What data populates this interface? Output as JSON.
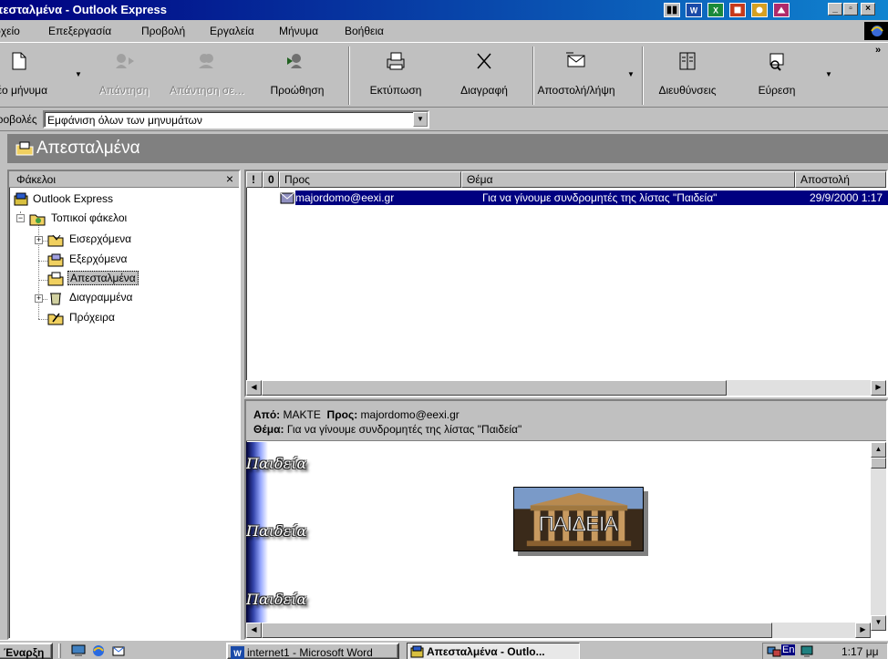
{
  "window": {
    "title": "Απεσταλμένα - Outlook Express"
  },
  "menu": [
    "Αρχείο",
    "Επεξεργασία",
    "Προβολή",
    "Εργαλεία",
    "Μήνυμα",
    "Βοήθεια"
  ],
  "toolbar": {
    "new_message": "Νέο μήνυμα",
    "reply": "Απάντηση",
    "reply_all": "Απάντηση σε όλους",
    "forward": "Προώθηση",
    "print": "Εκτύπωση",
    "delete": "Διαγραφή",
    "send_receive": "Αποστολή/λήψη",
    "addresses": "Διευθύνσεις",
    "find": "Εύρεση"
  },
  "viewbar": {
    "label": "Προβολές",
    "value": "Εμφάνιση όλων των μηνυμάτων"
  },
  "folder_header": "Απεσταλμένα",
  "folders": {
    "title": "Φάκελοι",
    "close": "×",
    "root": "Outlook Express",
    "local": "Τοπικοί φάκελοι",
    "inbox": "Εισερχόμενα",
    "outbox": "Εξερχόμενα",
    "sent": "Απεσταλμένα",
    "deleted": "Διαγραμμένα",
    "drafts": "Πρόχειρα"
  },
  "columns": {
    "priority": "!",
    "attach": "0",
    "to": "Προς",
    "subject": "Θέμα",
    "sent": "Αποστολή"
  },
  "messages": [
    {
      "to": "majordomo@eexi.gr",
      "subject": "Για να γίνουμε συνδρομητές της λίστας \"Παιδεία\"",
      "sent": "29/9/2000 1:17"
    }
  ],
  "preview": {
    "from_label": "Από:",
    "from": "MAKTE",
    "to_label": "Προς:",
    "to": "majordomo@eexi.gr",
    "subject_label": "Θέμα:",
    "subject": "Για να γίνουμε συνδρομητές της λίστας \"Παιδεία\"",
    "logo_text": "Παιδεία",
    "banner_text": "ΠΑΙΔΕΙΑ"
  },
  "taskbar": {
    "start": "Έναρξη",
    "tasks": [
      "internet1 - Microsoft Word",
      "Απεσταλμένα - Outlo..."
    ],
    "lang": "En",
    "clock": "1:17 μμ"
  },
  "colors": {
    "titlebar_start": "#000080",
    "titlebar_end": "#1084d0",
    "selection": "#000080",
    "face": "#c0c0c0"
  }
}
